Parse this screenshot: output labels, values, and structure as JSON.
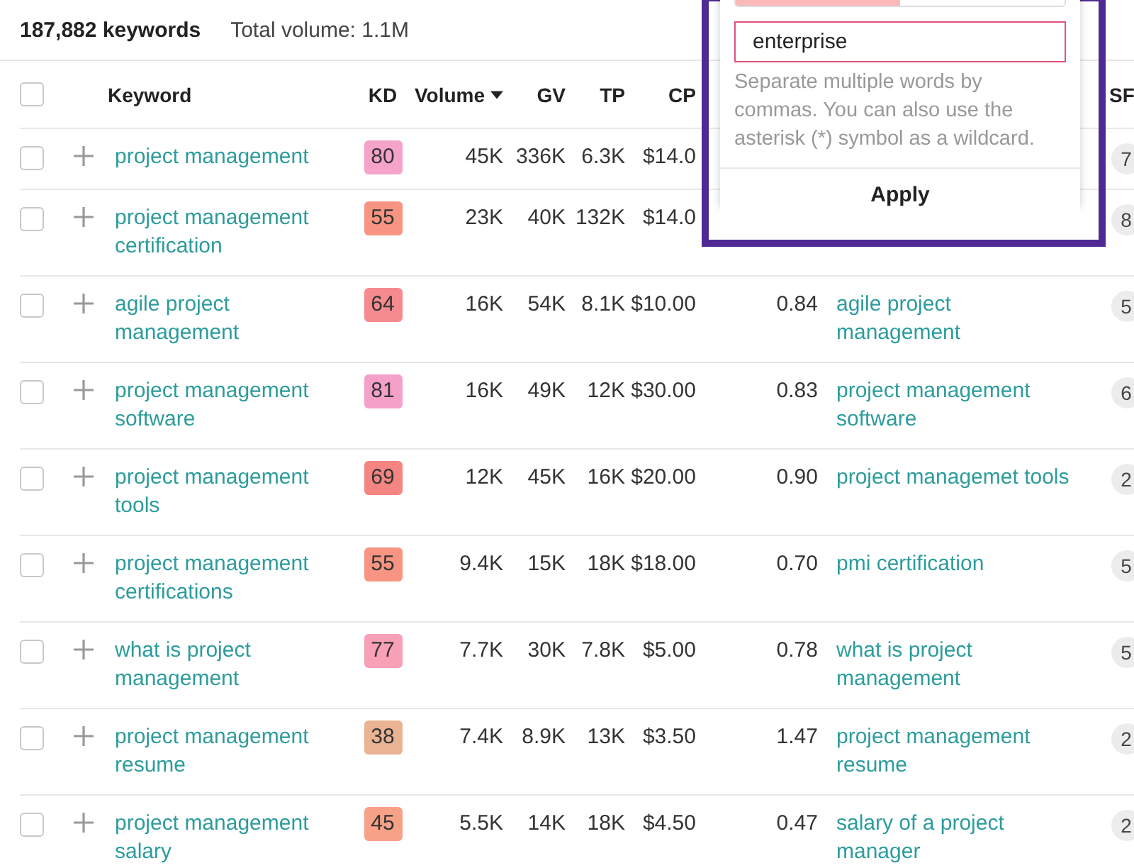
{
  "summary": {
    "keywords": "187,882 keywords",
    "total_volume": "Total volume: 1.1M"
  },
  "table": {
    "select_all_checked": false,
    "columns": [
      {
        "label": "Keyword",
        "sorted": false
      },
      {
        "label": "KD",
        "sorted": false
      },
      {
        "label": "Volume",
        "sorted": true
      },
      {
        "label": "GV",
        "sorted": false
      },
      {
        "label": "TP",
        "sorted": false
      },
      {
        "label": "CP",
        "sorted": false
      },
      {
        "label": "SF",
        "sorted": false
      }
    ],
    "rows": [
      {
        "checked": false,
        "keyword": "project management",
        "kd": {
          "value": "80",
          "color": "#f5a3c9"
        },
        "volume": "45K",
        "gv": "336K",
        "tp": "6.3K",
        "cpc": "$14.0",
        "sf": "7"
      },
      {
        "checked": false,
        "keyword": "project management certification",
        "kd": {
          "value": "55",
          "color": "#f89482"
        },
        "volume": "23K",
        "gv": "40K",
        "tp": "132K",
        "cpc": "$14.0",
        "sf": "8"
      },
      {
        "checked": false,
        "keyword": "agile project management",
        "kd": {
          "value": "64",
          "color": "#f58a8f"
        },
        "volume": "16K",
        "gv": "54K",
        "tp": "8.1K",
        "cpc": "$10.00",
        "cps": "0.84",
        "parent_topic": "agile project management",
        "sf": "5"
      },
      {
        "checked": false,
        "keyword": "project management software",
        "kd": {
          "value": "81",
          "color": "#f5a0c8"
        },
        "volume": "16K",
        "gv": "49K",
        "tp": "12K",
        "cpc": "$30.00",
        "cps": "0.83",
        "parent_topic": "project management software",
        "sf": "6"
      },
      {
        "checked": false,
        "keyword": "project management tools",
        "kd": {
          "value": "69",
          "color": "#f48582"
        },
        "volume": "12K",
        "gv": "45K",
        "tp": "16K",
        "cpc": "$20.00",
        "cps": "0.90",
        "parent_topic": "project managemet tools",
        "sf": "2"
      },
      {
        "checked": false,
        "keyword": "project management certifications",
        "kd": {
          "value": "55",
          "color": "#f89482"
        },
        "volume": "9.4K",
        "gv": "15K",
        "tp": "18K",
        "cpc": "$18.00",
        "cps": "0.70",
        "parent_topic": "pmi certification",
        "sf": "5"
      },
      {
        "checked": false,
        "keyword": "what is project management",
        "kd": {
          "value": "77",
          "color": "#f7a0b6"
        },
        "volume": "7.7K",
        "gv": "30K",
        "tp": "7.8K",
        "cpc": "$5.00",
        "cps": "0.78",
        "parent_topic": "what is project management",
        "sf": "5"
      },
      {
        "checked": false,
        "keyword": "project management resume",
        "kd": {
          "value": "38",
          "color": "#e9b394"
        },
        "volume": "7.4K",
        "gv": "8.9K",
        "tp": "13K",
        "cpc": "$3.50",
        "cps": "1.47",
        "parent_topic": "project management resume",
        "sf": "2"
      },
      {
        "checked": false,
        "keyword": "project management salary",
        "kd": {
          "value": "45",
          "color": "#f7a288"
        },
        "volume": "5.5K",
        "gv": "14K",
        "tp": "18K",
        "cpc": "$4.50",
        "cps": "0.47",
        "parent_topic": "salary of a project manager",
        "sf": "2"
      }
    ]
  },
  "filter_popup": {
    "segments": [
      {
        "selected": true
      },
      {
        "selected": false
      }
    ],
    "input_value": "enterprise",
    "hint": "Separate multiple words by commas. You can also use the asterisk (*) symbol as a wildcard.",
    "apply": "Apply"
  }
}
